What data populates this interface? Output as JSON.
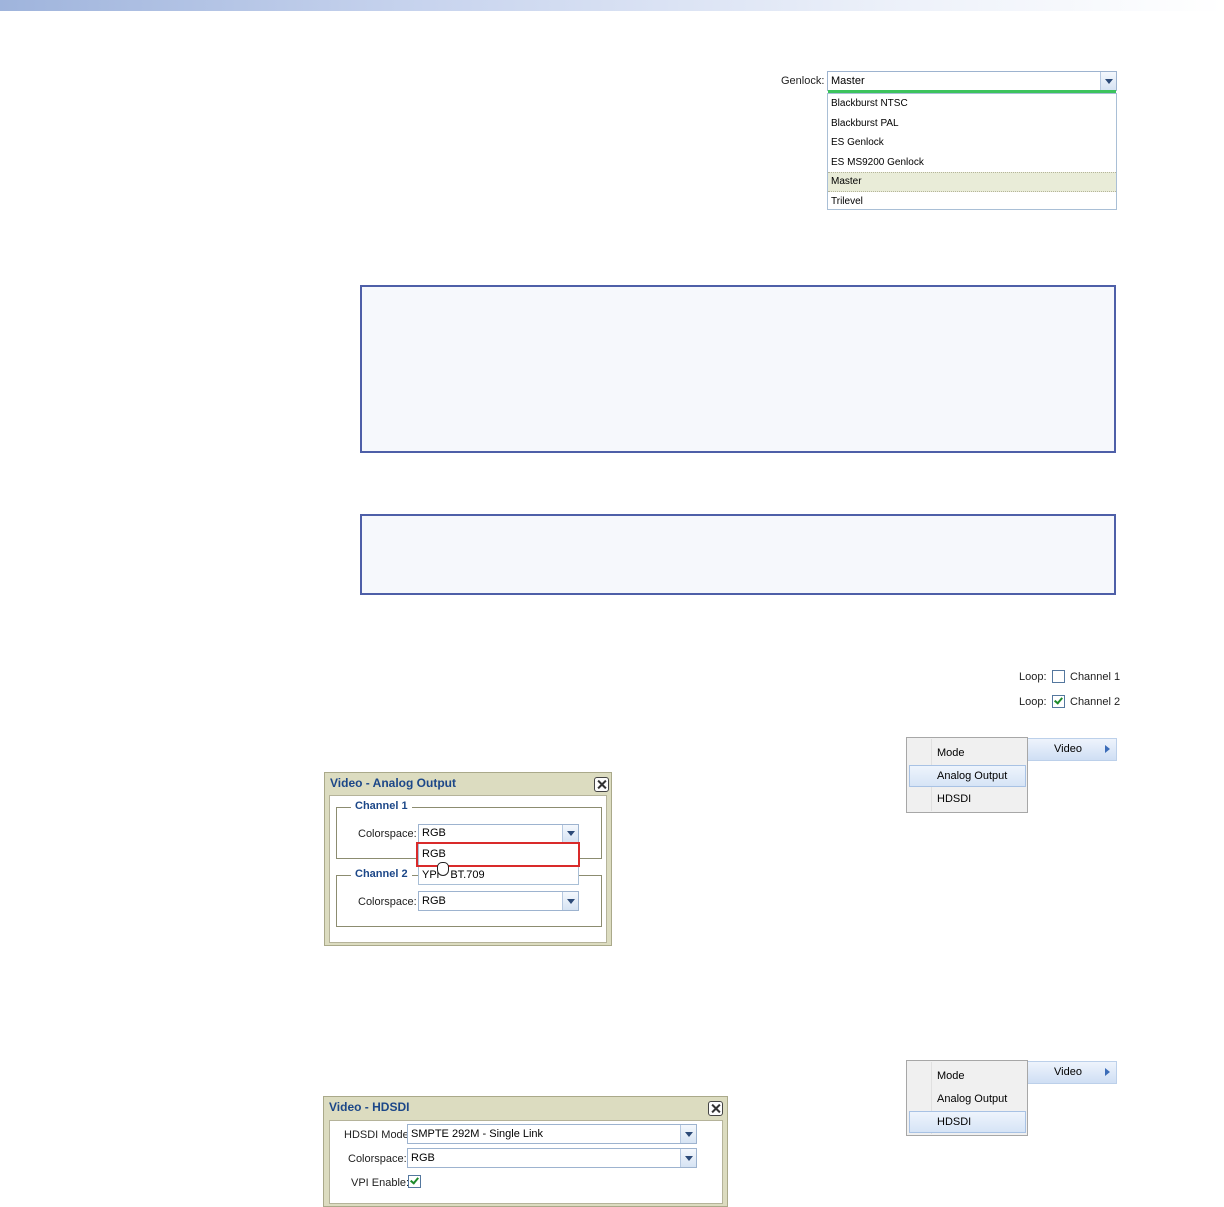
{
  "genlock": {
    "label": "Genlock:",
    "value": "Master",
    "options": [
      "Blackburst NTSC",
      "Blackburst PAL",
      "ES Genlock",
      "ES MS9200 Genlock",
      "Master",
      "Trilevel"
    ],
    "selected_index": 4
  },
  "loop": {
    "items": [
      {
        "label": "Loop:",
        "channel": "Channel 1",
        "checked": false
      },
      {
        "label": "Loop:",
        "channel": "Channel 2",
        "checked": true
      }
    ]
  },
  "menu1": {
    "items": [
      "Mode",
      "Analog Output",
      "HDSDI"
    ],
    "highlighted": "Analog Output",
    "submenu_label": "Video"
  },
  "menu2": {
    "items": [
      "Mode",
      "Analog Output",
      "HDSDI"
    ],
    "highlighted": "HDSDI",
    "submenu_label": "Video"
  },
  "analog_dialog": {
    "title": "Video - Analog Output",
    "channel1": {
      "legend": "Channel 1",
      "label": "Colorspace:",
      "value": "RGB"
    },
    "dropdown_options": [
      "RGB",
      "YPr",
      "BT.709"
    ],
    "channel2": {
      "legend": "Channel 2",
      "label": "Colorspace:",
      "value": "RGB"
    }
  },
  "hdsdi_dialog": {
    "title": "Video - HDSDI",
    "mode_label": "HDSDI Mode:",
    "mode_value": "SMPTE 292M - Single Link",
    "colorspace_label": "Colorspace:",
    "colorspace_value": "RGB",
    "vpi_label": "VPI Enable:",
    "vpi_checked": true
  },
  "colors": {
    "accent_blue": "#1c4788",
    "dialog_bg": "#dcdcc0",
    "highlight_red": "#d92a2a",
    "focus_green": "#3cc35d"
  }
}
